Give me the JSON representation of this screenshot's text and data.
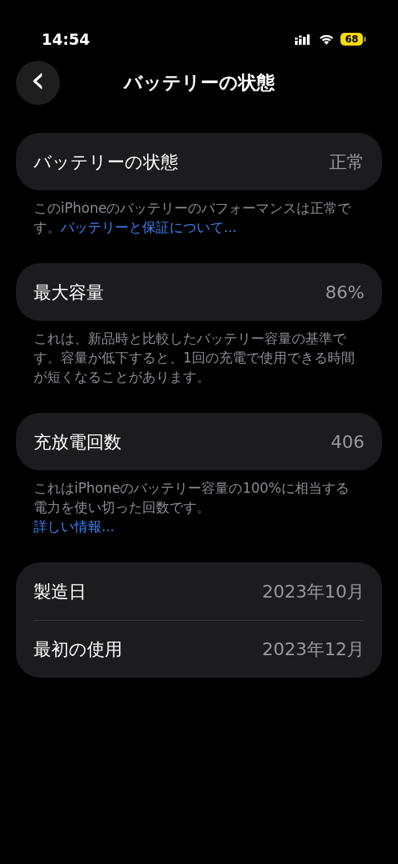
{
  "status_bar": {
    "time": "14:54",
    "battery": "68"
  },
  "nav": {
    "title": "バッテリーの状態",
    "back": "‹"
  },
  "sections": [
    {
      "rows": [
        {
          "label": "バッテリーの状態",
          "value": "正常"
        }
      ],
      "footer": {
        "text": "このiPhoneのバッテリーのパフォーマンスは正常です。",
        "link": "バッテリーと保証について...",
        "link_block": false
      }
    },
    {
      "rows": [
        {
          "label": "最大容量",
          "value": "86%"
        }
      ],
      "footer": {
        "text": "これは、新品時と比較したバッテリー容量の基準です。容量が低下すると、1回の充電で使用できる時間が短くなることがあります。"
      }
    },
    {
      "rows": [
        {
          "label": "充放電回数",
          "value": "406"
        }
      ],
      "footer": {
        "text": "これはiPhoneのバッテリー容量の100%に相当する電力を使い切った回数です。",
        "link": "詳しい情報...",
        "link_block": true
      }
    },
    {
      "rows": [
        {
          "label": "製造日",
          "value": "2023年10月"
        },
        {
          "label": "最初の使用",
          "value": "2023年12月"
        }
      ]
    }
  ]
}
